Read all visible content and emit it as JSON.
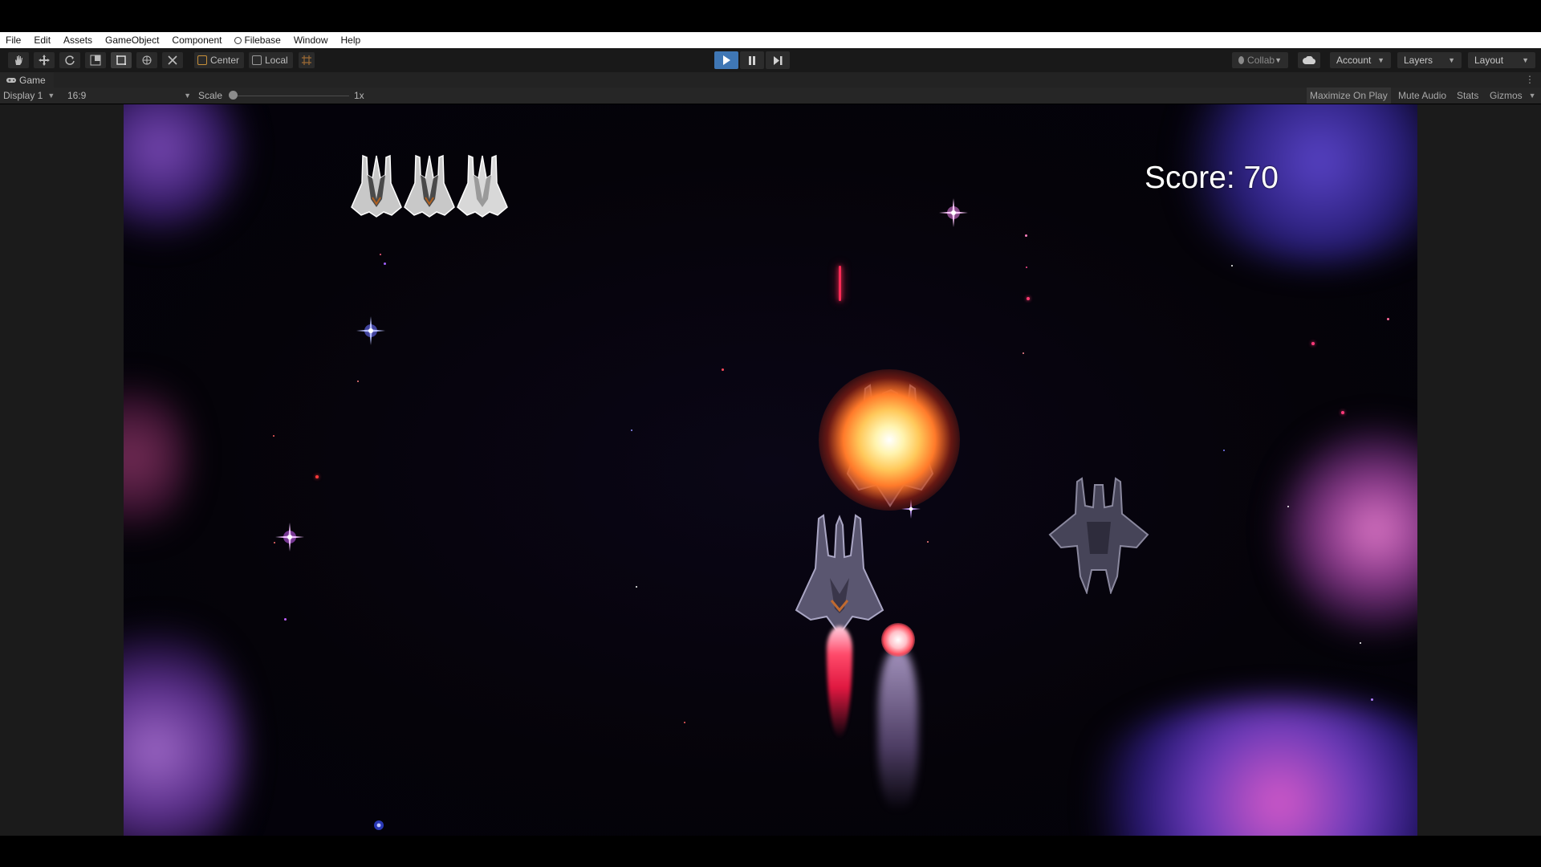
{
  "menu": [
    "File",
    "Edit",
    "Assets",
    "GameObject",
    "Component",
    "Filebase",
    "Window",
    "Help"
  ],
  "toolbar": {
    "tools": [
      "hand-icon",
      "move-icon",
      "rotate-icon",
      "scale-icon",
      "rect-tool-icon",
      "transform-icon",
      "custom-tool-icon"
    ],
    "pivot_mode": "Center",
    "pivot_rotation": "Local",
    "collab": "Collab",
    "account": "Account",
    "layers": "Layers",
    "layout": "Layout"
  },
  "game_tab": {
    "label": "Game"
  },
  "game_bar": {
    "display": "Display 1",
    "aspect": "16:9",
    "scale_label": "Scale",
    "scale_value": "1x",
    "maximize": "Maximize On Play",
    "mute": "Mute Audio",
    "stats": "Stats",
    "gizmos": "Gizmos"
  },
  "game": {
    "score_text": "Score: 70",
    "lives": 3
  },
  "colors": {
    "play_active": "#3f77b5",
    "score_text": "#ffffff",
    "laser": "#ff2a55"
  }
}
